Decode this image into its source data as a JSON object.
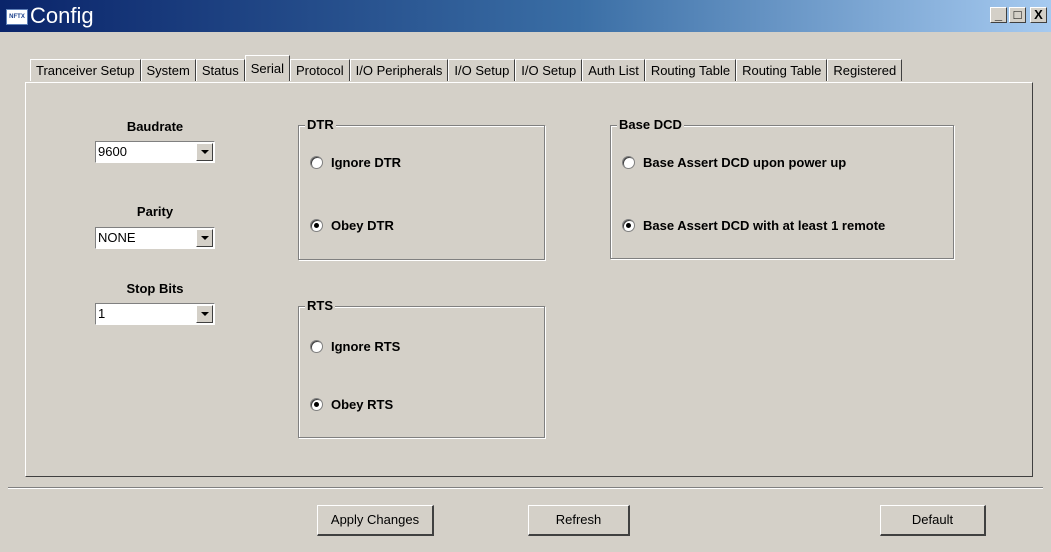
{
  "window": {
    "icon_text": "NFTX",
    "title": "Config",
    "minimize": "_",
    "maximize": "□",
    "close": "X"
  },
  "tabs": [
    {
      "label": "Tranceiver Setup",
      "active": false
    },
    {
      "label": "System",
      "active": false
    },
    {
      "label": "Status",
      "active": false
    },
    {
      "label": "Serial",
      "active": true
    },
    {
      "label": "Protocol",
      "active": false
    },
    {
      "label": "I/O Peripherals",
      "active": false
    },
    {
      "label": "I/O Setup",
      "active": false
    },
    {
      "label": "I/O Setup",
      "active": false
    },
    {
      "label": "Auth List",
      "active": false
    },
    {
      "label": "Routing Table",
      "active": false
    },
    {
      "label": "Routing Table",
      "active": false
    },
    {
      "label": "Registered",
      "active": false
    }
  ],
  "serial": {
    "baudrate": {
      "label": "Baudrate",
      "value": "9600"
    },
    "parity": {
      "label": "Parity",
      "value": "NONE"
    },
    "stop_bits": {
      "label": "Stop Bits",
      "value": "1"
    }
  },
  "dtr": {
    "legend": "DTR",
    "options": [
      {
        "label": "Ignore DTR",
        "selected": false
      },
      {
        "label": "Obey DTR",
        "selected": true
      }
    ]
  },
  "rts": {
    "legend": "RTS",
    "options": [
      {
        "label": "Ignore RTS",
        "selected": false
      },
      {
        "label": "Obey RTS",
        "selected": true
      }
    ]
  },
  "base_dcd": {
    "legend": "Base DCD",
    "options": [
      {
        "label": "Base Assert DCD upon power up",
        "selected": false
      },
      {
        "label": "Base Assert DCD with at least 1 remote",
        "selected": true
      }
    ]
  },
  "buttons": {
    "apply": "Apply Changes",
    "refresh": "Refresh",
    "default": "Default"
  }
}
